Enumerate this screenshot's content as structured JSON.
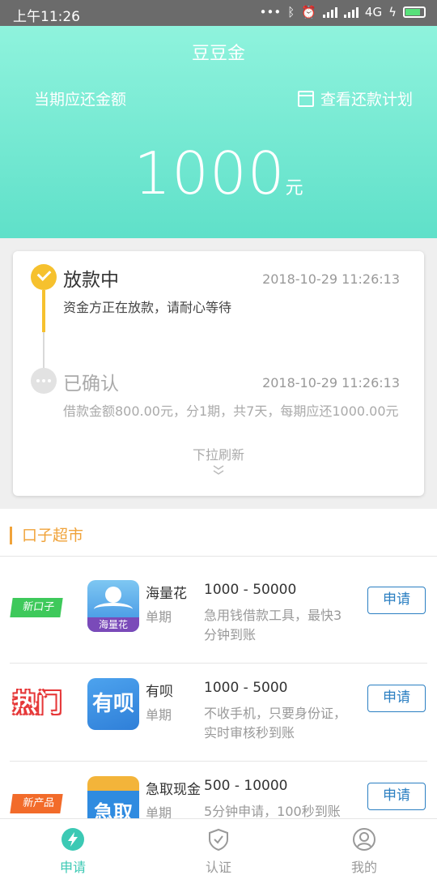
{
  "status_bar": {
    "time": "上午11:26",
    "network": "4G"
  },
  "header": {
    "app_title": "豆豆金",
    "due_label": "当期应还金额",
    "plan_link": "查看还款计划",
    "amount": "1000",
    "amount_unit": "元"
  },
  "status_card": {
    "steps": [
      {
        "title": "放款中",
        "time": "2018-10-29 11:26:13",
        "desc": "资金方正在放款，请耐心等待"
      },
      {
        "title": "已确认",
        "time": "2018-10-29 11:26:13",
        "desc": "借款金额800.00元，分1期，共7天，每期应还1000.00元"
      }
    ],
    "pull_hint": "下拉刷新"
  },
  "market": {
    "title": "口子超市",
    "products": [
      {
        "tag": "新口子",
        "logo_text": "海量花",
        "name": "海量花",
        "term": "单期",
        "range": "1000 - 50000",
        "desc": "急用钱借款工具，最快3分钟到账",
        "button": "申请"
      },
      {
        "tag": "热门",
        "logo_text": "有呗",
        "name": "有呗",
        "term": "单期",
        "range": "1000 - 5000",
        "desc": "不收手机，只要身份证，实时审核秒到账",
        "button": "申请"
      },
      {
        "tag": "新产品",
        "logo_text": "急取",
        "name": "急取现金",
        "term": "单期",
        "range": "500 - 10000",
        "desc": "5分钟申请，100秒到账",
        "button": "申请"
      }
    ]
  },
  "tabbar": {
    "tabs": [
      {
        "label": "申请",
        "icon": "lightning-icon",
        "active": true
      },
      {
        "label": "认证",
        "icon": "shield-check-icon",
        "active": false
      },
      {
        "label": "我的",
        "icon": "user-icon",
        "active": false
      }
    ]
  },
  "colors": {
    "accent": "#3cc9b4",
    "header_top": "#8ff3dd",
    "header_bottom": "#5fe0c9",
    "step_active": "#f6c12e",
    "market_title": "#f0a33a",
    "button": "#2b7fc2"
  }
}
